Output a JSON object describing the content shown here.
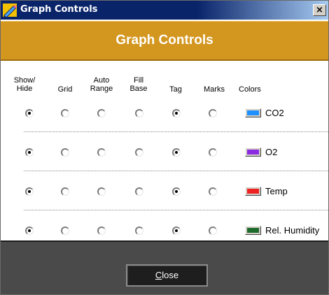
{
  "window": {
    "title": "Graph Controls",
    "close_glyph": "×",
    "icon": "pencil-graph-icon"
  },
  "header": {
    "title": "Graph Controls",
    "color": "#d3961e"
  },
  "columns": {
    "show_hide": "Show/\nHide",
    "grid": "Grid",
    "auto_range": "Auto\nRange",
    "fill_base": "Fill\nBase",
    "tag": "Tag",
    "marks": "Marks",
    "colors": "Colors"
  },
  "series": [
    {
      "label": "CO2",
      "color": "#1e90ff",
      "show_hide": true,
      "grid": false,
      "auto_range": false,
      "fill_base": false,
      "tag": true,
      "marks": false
    },
    {
      "label": "O2",
      "color": "#8a2be2",
      "show_hide": true,
      "grid": false,
      "auto_range": false,
      "fill_base": false,
      "tag": true,
      "marks": false
    },
    {
      "label": "Temp",
      "color": "#ee2222",
      "show_hide": true,
      "grid": false,
      "auto_range": false,
      "fill_base": false,
      "tag": true,
      "marks": false
    },
    {
      "label": "Rel. Humidity",
      "color": "#1e6b2e",
      "show_hide": true,
      "grid": false,
      "auto_range": false,
      "fill_base": false,
      "tag": true,
      "marks": false
    }
  ],
  "footer": {
    "close_mnemonic": "C",
    "close_rest": "lose"
  }
}
